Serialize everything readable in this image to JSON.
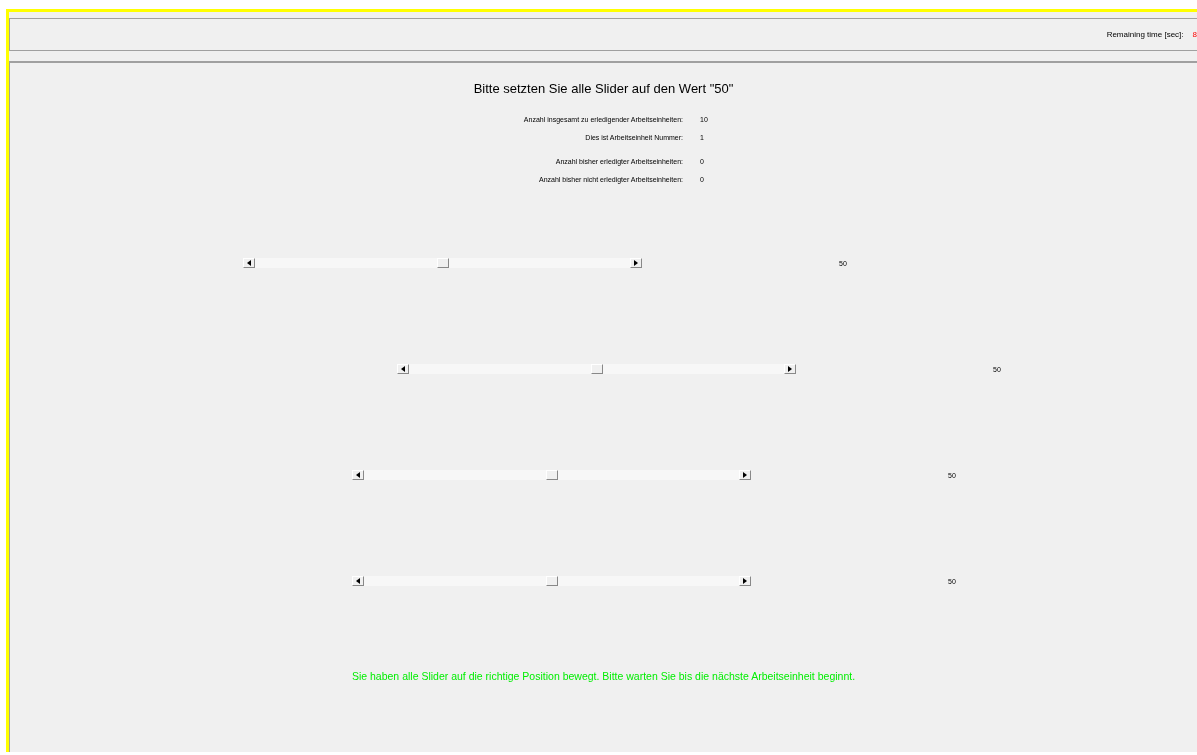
{
  "header": {
    "remaining_label": "Remaining time [sec]:",
    "remaining_value": "8"
  },
  "title": "Bitte setzten Sie alle Slider auf den Wert \"50\"",
  "info_groups": [
    [
      {
        "label": "Anzahl insgesamt zu erledigender Arbeitseinheiten:",
        "value": "10"
      },
      {
        "label": "Dies ist Arbeitseinheit Nummer:",
        "value": "1"
      }
    ],
    [
      {
        "label": "Anzahl bisher erledigter Arbeitseinheiten:",
        "value": "0"
      },
      {
        "label": "Anzahl bisher nicht erledigter Arbeitseinheiten:",
        "value": "0"
      }
    ]
  ],
  "sliders": [
    {
      "level": 0.5,
      "reading": "50"
    },
    {
      "level": 0.5,
      "reading": "50"
    },
    {
      "level": 0.5,
      "reading": "50"
    },
    {
      "level": 0.5,
      "reading": "50"
    }
  ],
  "message": "Sie haben alle Slider auf die richtige Position bewegt. Bitte warten Sie bis die nächste Arbeitseinheit beginnt."
}
